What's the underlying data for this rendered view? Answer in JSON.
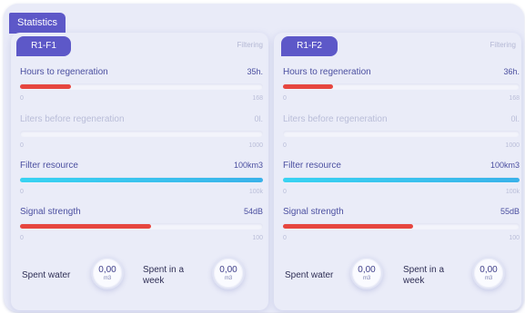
{
  "header": {
    "tab_label": "Statistics"
  },
  "panels": [
    {
      "tab": "R1-F1",
      "status": "Filtering",
      "metrics": [
        {
          "label": "Hours to regeneration",
          "value": "35h.",
          "min": "0",
          "max": "168",
          "fill_pct": 21,
          "color": "red",
          "enabled": true
        },
        {
          "label": "Liters before regeneration",
          "value": "0l.",
          "min": "0",
          "max": "1000",
          "fill_pct": 0,
          "color": "red",
          "enabled": false
        },
        {
          "label": "Filter resource",
          "value": "100km3",
          "min": "0",
          "max": "100k",
          "fill_pct": 100,
          "color": "cyan",
          "enabled": true
        },
        {
          "label": "Signal strength",
          "value": "54dB",
          "min": "0",
          "max": "100",
          "fill_pct": 54,
          "color": "red",
          "enabled": true
        }
      ],
      "spent_water": {
        "label": "Spent water",
        "value": "0,00",
        "unit": "m3"
      },
      "spent_week": {
        "label": "Spent in a week",
        "value": "0,00",
        "unit": "m3"
      }
    },
    {
      "tab": "R1-F2",
      "status": "Filtering",
      "metrics": [
        {
          "label": "Hours to regeneration",
          "value": "36h.",
          "min": "0",
          "max": "168",
          "fill_pct": 21,
          "color": "red",
          "enabled": true
        },
        {
          "label": "Liters before regeneration",
          "value": "0l.",
          "min": "0",
          "max": "1000",
          "fill_pct": 0,
          "color": "red",
          "enabled": false
        },
        {
          "label": "Filter resource",
          "value": "100km3",
          "min": "0",
          "max": "100k",
          "fill_pct": 100,
          "color": "cyan",
          "enabled": true
        },
        {
          "label": "Signal strength",
          "value": "55dB",
          "min": "0",
          "max": "100",
          "fill_pct": 55,
          "color": "red",
          "enabled": true
        }
      ],
      "spent_water": {
        "label": "Spent water",
        "value": "0,00",
        "unit": "m3"
      },
      "spent_week": {
        "label": "Spent in a week",
        "value": "0,00",
        "unit": "m3"
      }
    }
  ],
  "colors": {
    "accent": "#5d58c8",
    "red": "#e6463f",
    "cyan": "#39c6ef",
    "panel_bg": "#eaecf8"
  }
}
